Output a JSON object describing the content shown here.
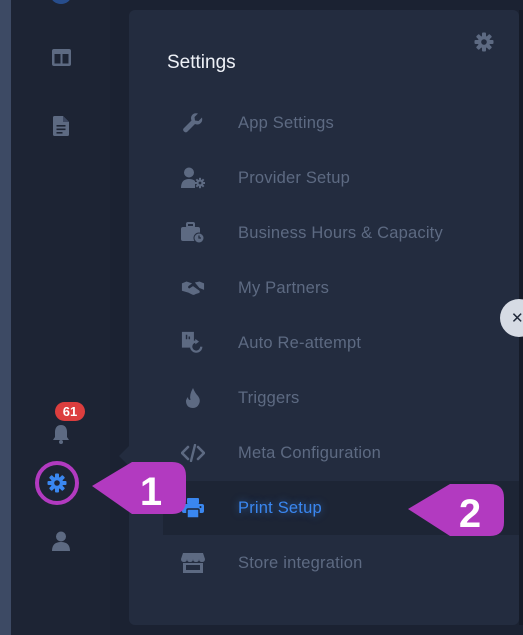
{
  "sidebar": {
    "icons": [
      "dashboard-icon",
      "document-icon",
      "bell-icon",
      "gear-icon",
      "user-icon"
    ],
    "notification_count": "61"
  },
  "panel": {
    "title": "Settings",
    "menu_items": [
      {
        "label": "App Settings",
        "icon": "wrench-icon"
      },
      {
        "label": "Provider Setup",
        "icon": "user-gear-icon"
      },
      {
        "label": "Business Hours & Capacity",
        "icon": "briefcase-clock-icon"
      },
      {
        "label": "My Partners",
        "icon": "handshake-icon"
      },
      {
        "label": "Auto Re-attempt",
        "icon": "retry-icon"
      },
      {
        "label": "Triggers",
        "icon": "flame-icon"
      },
      {
        "label": "Meta Configuration",
        "icon": "code-icon"
      },
      {
        "label": "Print Setup",
        "icon": "printer-icon",
        "selected": true
      },
      {
        "label": "Store integration",
        "icon": "store-icon"
      }
    ]
  },
  "annotations": {
    "step1": "1",
    "step2": "2"
  },
  "colors": {
    "accent": "#3a87f0",
    "callout": "#b23ac0",
    "badge": "#dc3e3e"
  }
}
